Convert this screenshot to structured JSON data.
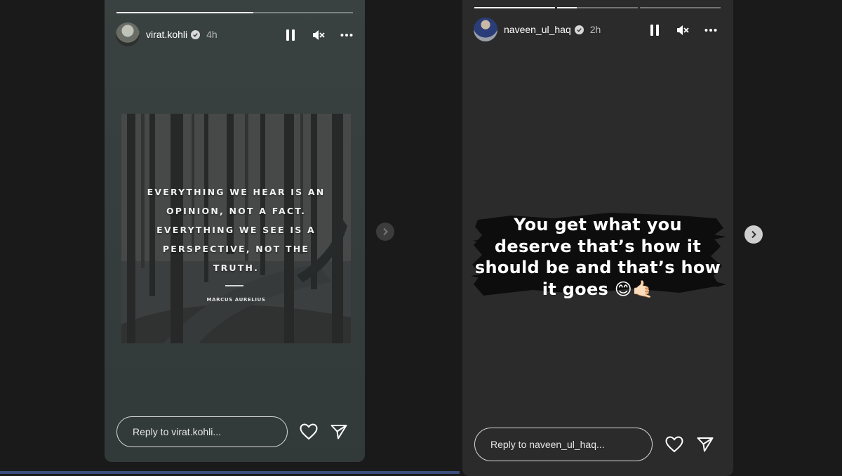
{
  "stories": [
    {
      "username": "virat.kohli",
      "time": "4h",
      "verified": true,
      "progress_fill": 0.58,
      "quote": {
        "text": "EVERYTHING WE HEAR IS AN OPINION, NOT A FACT. EVERYTHING WE SEE IS A PERSPECTIVE, NOT THE TRUTH.",
        "author": "MARCUS AURELIUS"
      },
      "reply_placeholder": "Reply to virat.kohli..."
    },
    {
      "username": "naveen_ul_haq",
      "time": "2h",
      "verified": true,
      "segments_fill": [
        1.0,
        0.24,
        0.0
      ],
      "sticker_lines": [
        "You get what you",
        "deserve that’s how it",
        "should be and that’s how",
        "it goes 😊🤙🏻"
      ],
      "reply_placeholder": "Reply to naveen_ul_haq..."
    }
  ],
  "icons": {
    "pause": "pause-icon",
    "mute": "mute-icon",
    "more": "more-icon",
    "like": "heart-icon",
    "share": "send-icon",
    "next": "chevron-right-icon"
  }
}
